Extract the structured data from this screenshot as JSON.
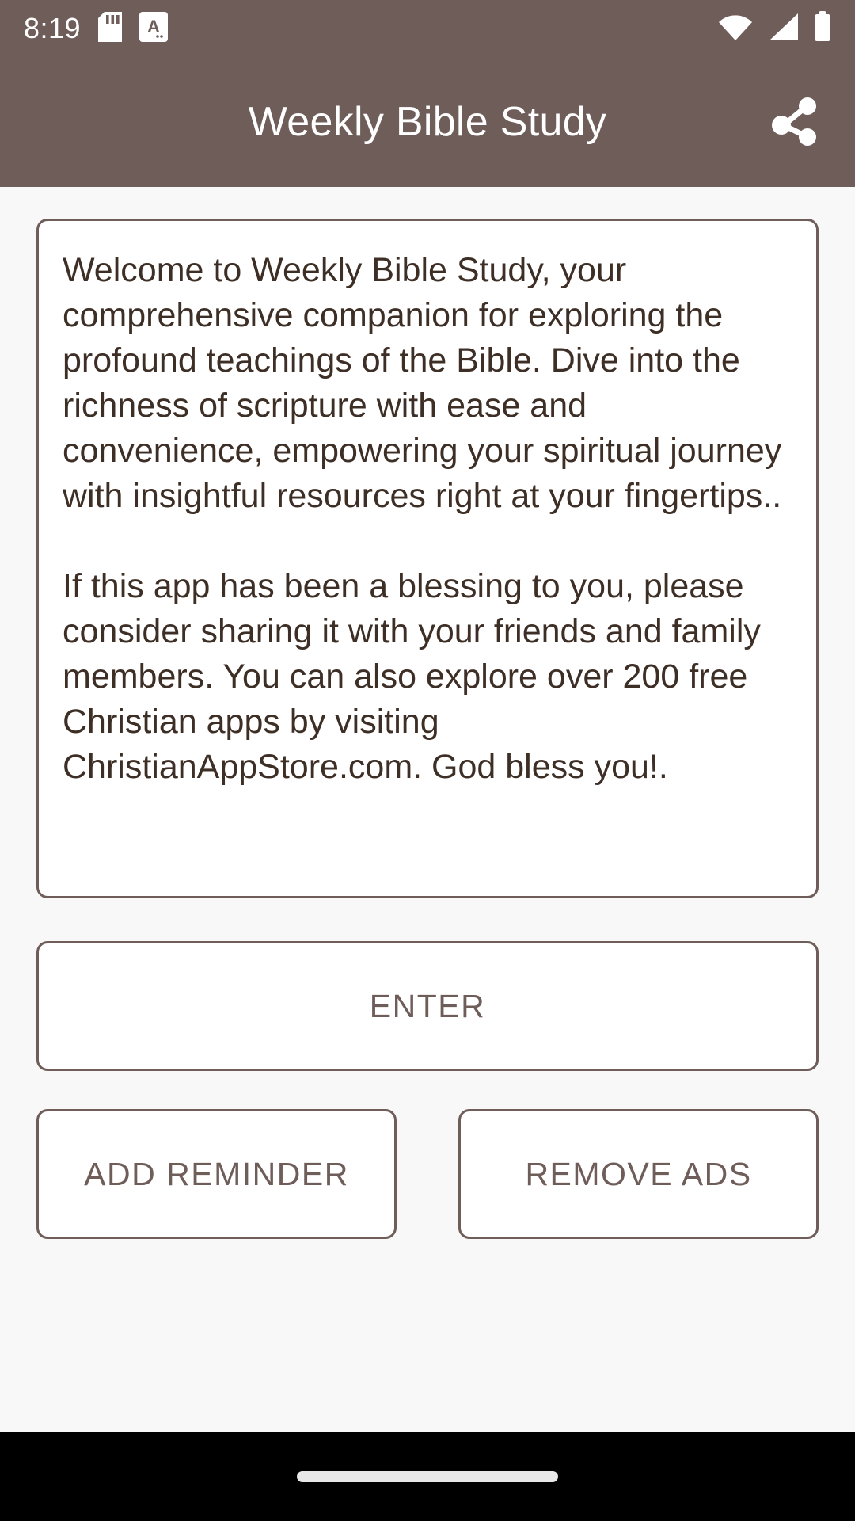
{
  "status_bar": {
    "time": "8:19",
    "icons": [
      "sd-card-icon",
      "screenshot-a-icon",
      "wifi-icon",
      "cellular-signal-icon",
      "battery-icon"
    ]
  },
  "app_bar": {
    "title": "Weekly Bible Study",
    "share_icon": "share-icon",
    "background_color": "#6F5D5A",
    "title_color": "#FFFFFF"
  },
  "welcome_card": {
    "paragraph_1": "Welcome to Weekly Bible Study, your comprehensive companion for exploring the profound teachings of the Bible. Dive into the richness of scripture with ease and convenience, empowering your spiritual journey with insightful resources right at your fingertips..",
    "paragraph_2": "If this app has been a blessing to you, please consider sharing it with your friends and family members. You can also explore over 200 free Christian apps by visiting ChristianAppStore.com. God bless you!.",
    "text_color": "#3E2F26",
    "border_color": "#6F5D5A"
  },
  "buttons": {
    "enter": "ENTER",
    "add_reminder": "ADD REMINDER",
    "remove_ads": "REMOVE ADS",
    "text_color": "#6F5D5A",
    "border_color": "#6F5D5A"
  },
  "nav_bar": {
    "gesture_pill": "home-gesture-pill",
    "background_color": "#000000"
  },
  "theme": {
    "page_background": "#F8F8F8",
    "accent": "#6F5D5A"
  }
}
